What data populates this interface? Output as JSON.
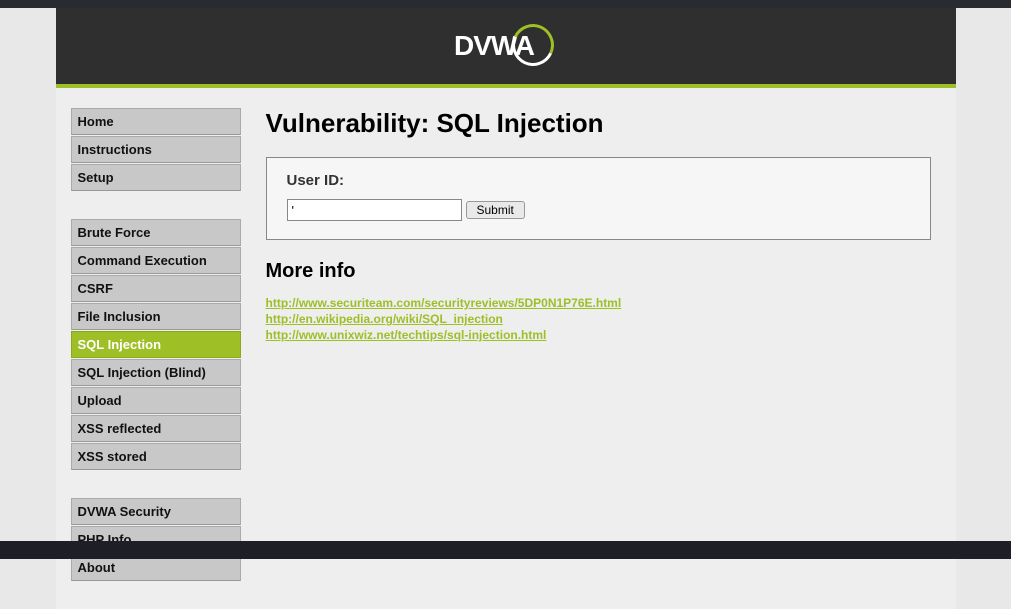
{
  "logo": {
    "text": "DVWA"
  },
  "nav": {
    "group1": [
      {
        "label": "Home",
        "active": false
      },
      {
        "label": "Instructions",
        "active": false
      },
      {
        "label": "Setup",
        "active": false
      }
    ],
    "group2": [
      {
        "label": "Brute Force",
        "active": false
      },
      {
        "label": "Command Execution",
        "active": false
      },
      {
        "label": "CSRF",
        "active": false
      },
      {
        "label": "File Inclusion",
        "active": false
      },
      {
        "label": "SQL Injection",
        "active": true
      },
      {
        "label": "SQL Injection (Blind)",
        "active": false
      },
      {
        "label": "Upload",
        "active": false
      },
      {
        "label": "XSS reflected",
        "active": false
      },
      {
        "label": "XSS stored",
        "active": false
      }
    ],
    "group3": [
      {
        "label": "DVWA Security",
        "active": false
      },
      {
        "label": "PHP Info",
        "active": false
      },
      {
        "label": "About",
        "active": false
      }
    ]
  },
  "main": {
    "title": "Vulnerability: SQL Injection",
    "form": {
      "label": "User ID:",
      "input_value": "'",
      "submit_label": "Submit"
    },
    "more_info_heading": "More info",
    "links": [
      "http://www.securiteam.com/securityreviews/5DP0N1P76E.html",
      "http://en.wikipedia.org/wiki/SQL_injection",
      "http://www.unixwiz.net/techtips/sql-injection.html"
    ]
  }
}
